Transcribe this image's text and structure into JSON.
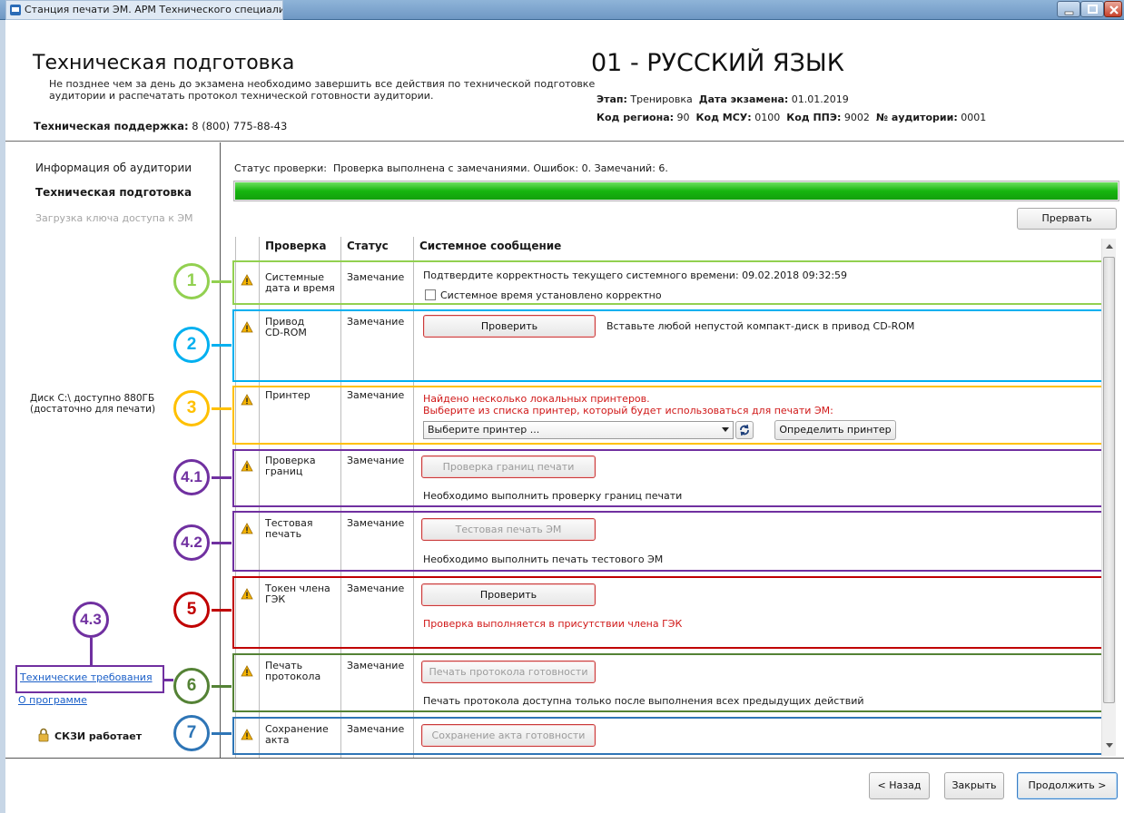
{
  "window": {
    "title": "Станция печати ЭМ. АРМ Технического специалиста"
  },
  "header": {
    "title": "Техническая подготовка",
    "description": "Не позднее чем за день до экзамена необходимо завершить все действия по технической подготовке аудитории и распечатать протокол технической готовности аудитории.",
    "support_label": "Техническая поддержка:",
    "support_phone": "8 (800) 775-88-43",
    "subject": "01 - РУССКИЙ ЯЗЫК",
    "stage_label": "Этап:",
    "stage_value": "Тренировка",
    "date_label": "Дата экзамена:",
    "date_value": "01.01.2019",
    "region_label": "Код региона:",
    "region_value": "90",
    "msu_label": "Код МСУ:",
    "msu_value": "0100",
    "ppe_label": "Код ППЭ:",
    "ppe_value": "9002",
    "room_label": "№ аудитории:",
    "room_value": "0001"
  },
  "sidebar": {
    "items": [
      {
        "label": "Информация об аудитории"
      },
      {
        "label": "Техническая подготовка"
      },
      {
        "label": "Загрузка ключа доступа к ЭМ"
      }
    ],
    "disk_line1": "Диск C:\\ доступно 880ГБ",
    "disk_line2": "(достаточно для печати)",
    "tech_req_link": "Технические требования",
    "about_link": "О программе",
    "skzi_status": "СКЗИ работает"
  },
  "content": {
    "status_label": "Статус проверки:",
    "status_text": "Проверка выполнена с замечаниями. Ошибок: 0. Замечаний: 6.",
    "progress_percent": 100,
    "abort_button": "Прервать",
    "columns": {
      "check": "Проверка",
      "status": "Статус",
      "message": "Системное сообщение"
    },
    "rows": [
      {
        "name1": "Системные",
        "name2": "дата и время",
        "status": "Замечание",
        "message": "Подтвердите корректность текущего системного времени: 09.02.2018 09:32:59",
        "checkbox_label": "Системное время установлено корректно"
      },
      {
        "name1": "Привод",
        "name2": "CD-ROM",
        "status": "Замечание",
        "button": "Проверить",
        "message": "Вставьте любой непустой компакт-диск в привод CD-ROM"
      },
      {
        "name1": "Принтер",
        "name2": "",
        "status": "Замечание",
        "message1": "Найдено несколько локальных принтеров.",
        "message2": "Выберите из списка принтер, который будет использоваться для печати ЭМ:",
        "select_placeholder": "Выберите принтер ...",
        "detect_button": "Определить принтер"
      },
      {
        "name1": "Проверка",
        "name2": "границ",
        "status": "Замечание",
        "button": "Проверка границ печати",
        "message": "Необходимо выполнить проверку границ печати"
      },
      {
        "name1": "Тестовая",
        "name2": "печать",
        "status": "Замечание",
        "button": "Тестовая печать ЭМ",
        "message": "Необходимо выполнить печать тестового ЭМ"
      },
      {
        "name1": "Токен члена",
        "name2": "ГЭК",
        "status": "Замечание",
        "button": "Проверить",
        "message": "Проверка выполняется в присутствии члена ГЭК"
      },
      {
        "name1": "Печать",
        "name2": "протокола",
        "status": "Замечание",
        "button": "Печать протокола готовности",
        "message": "Печать протокола доступна только после выполнения всех предыдущих действий"
      },
      {
        "name1": "Сохранение",
        "name2": "акта",
        "status": "Замечание",
        "button": "Сохранение акта готовности"
      }
    ]
  },
  "annotations": [
    {
      "label": "1",
      "color": "#92d050"
    },
    {
      "label": "2",
      "color": "#00b0f0"
    },
    {
      "label": "3",
      "color": "#ffc000"
    },
    {
      "label": "4.1",
      "color": "#7030a0"
    },
    {
      "label": "4.2",
      "color": "#7030a0"
    },
    {
      "label": "5",
      "color": "#c00000"
    },
    {
      "label": "4.3",
      "color": "#7030a0"
    },
    {
      "label": "6",
      "color": "#548235"
    },
    {
      "label": "7",
      "color": "#2e75b6"
    }
  ],
  "footer": {
    "back": "< Назад",
    "close": "Закрыть",
    "next": "Продолжить >"
  }
}
